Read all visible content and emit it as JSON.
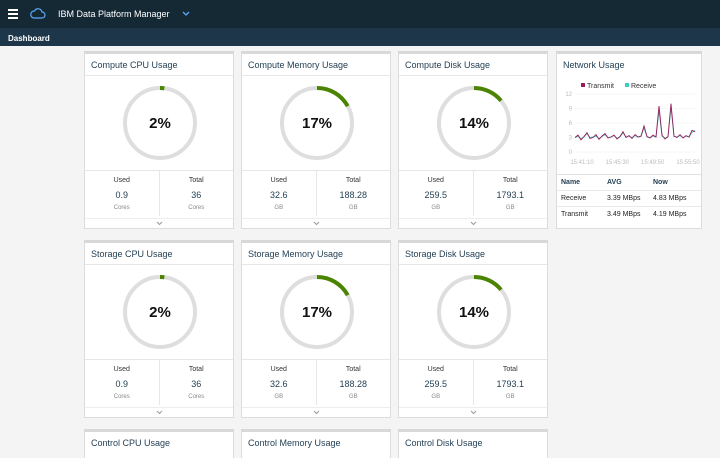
{
  "header": {
    "app_title": "IBM Data Platform Manager",
    "menu_icon": "hamburger-icon",
    "logo_icon": "cloud-icon",
    "switcher_icon": "chevron-down-icon"
  },
  "subheader": {
    "title": "Dashboard"
  },
  "cards": [
    {
      "title": "Compute CPU Usage",
      "percent": "2%",
      "fraction": 0.02,
      "used_label": "Used",
      "used": "0.9",
      "used_unit": "Cores",
      "total_label": "Total",
      "total": "36",
      "total_unit": "Cores"
    },
    {
      "title": "Compute Memory Usage",
      "percent": "17%",
      "fraction": 0.17,
      "used_label": "Used",
      "used": "32.6",
      "used_unit": "GB",
      "total_label": "Total",
      "total": "188.28",
      "total_unit": "GB"
    },
    {
      "title": "Compute Disk Usage",
      "percent": "14%",
      "fraction": 0.14,
      "used_label": "Used",
      "used": "259.5",
      "used_unit": "GB",
      "total_label": "Total",
      "total": "1793.1",
      "total_unit": "GB"
    },
    {
      "title": "Storage CPU Usage",
      "percent": "2%",
      "fraction": 0.02,
      "used_label": "Used",
      "used": "0.9",
      "used_unit": "Cores",
      "total_label": "Total",
      "total": "36",
      "total_unit": "Cores"
    },
    {
      "title": "Storage Memory Usage",
      "percent": "17%",
      "fraction": 0.17,
      "used_label": "Used",
      "used": "32.6",
      "used_unit": "GB",
      "total_label": "Total",
      "total": "188.28",
      "total_unit": "GB"
    },
    {
      "title": "Storage Disk Usage",
      "percent": "14%",
      "fraction": 0.14,
      "used_label": "Used",
      "used": "259.5",
      "used_unit": "GB",
      "total_label": "Total",
      "total": "1793.1",
      "total_unit": "GB"
    },
    {
      "title": "Control CPU Usage"
    },
    {
      "title": "Control Memory Usage"
    },
    {
      "title": "Control Disk Usage"
    }
  ],
  "network": {
    "title": "Network Usage",
    "legend": [
      {
        "name": "Transmit",
        "color": "#9b1d5a"
      },
      {
        "name": "Receive",
        "color": "#3ecbc4"
      }
    ],
    "table": {
      "headers": [
        "Name",
        "AVG",
        "Now"
      ],
      "rows": [
        [
          "Receive",
          "3.39 MBps",
          "4.83 MBps"
        ],
        [
          "Transmit",
          "3.49 MBps",
          "4.19 MBps"
        ]
      ]
    }
  },
  "colors": {
    "gauge_fill": "#4b8400",
    "gauge_track": "#dedede",
    "topbar": "#152935",
    "subbar": "#1d3649"
  },
  "chart_data": {
    "type": "line",
    "ylim": [
      0,
      12
    ],
    "y_ticks": [
      "0",
      "3",
      "6",
      "9",
      "12"
    ],
    "x_ticks": [
      "15:41:10",
      "15:45:30",
      "15:49:50",
      "15:55:50"
    ],
    "x": [
      0,
      1,
      2,
      3,
      4,
      5,
      6,
      7,
      8,
      9,
      10,
      11,
      12,
      13,
      14,
      15,
      16,
      17,
      18,
      19,
      20,
      21,
      22,
      23,
      24,
      25,
      26,
      27,
      28,
      29,
      30,
      31,
      32,
      33,
      34,
      35,
      36,
      37,
      38,
      39,
      40
    ],
    "series": [
      {
        "name": "Transmit",
        "values": [
          3,
          3.5,
          2.5,
          3.2,
          4,
          2.8,
          3,
          3.6,
          2.6,
          3.3,
          3.8,
          2.9,
          3.1,
          3.5,
          2.7,
          3.2,
          4.2,
          3,
          3.4,
          2.8,
          3.6,
          3.1,
          3.3,
          5.4,
          3.2,
          2.9,
          3.5,
          3.1,
          9.5,
          3.5,
          2.7,
          3.2,
          10,
          3.3,
          3,
          3.6,
          2.9,
          3.4,
          3.1,
          4.5,
          4.2
        ]
      },
      {
        "name": "Receive",
        "values": [
          3,
          3.2,
          2.8,
          3.1,
          3.8,
          3,
          3.1,
          3.3,
          2.8,
          3.2,
          3.6,
          3,
          3.1,
          3.4,
          2.9,
          3.1,
          4,
          3.1,
          3.3,
          3,
          3.4,
          3.1,
          3.2,
          5,
          3.1,
          3,
          3.3,
          3.1,
          8.6,
          3.3,
          2.9,
          3.1,
          9.2,
          3.2,
          3.1,
          3.4,
          3,
          3.3,
          3.1,
          4.1,
          4.4
        ]
      }
    ]
  }
}
